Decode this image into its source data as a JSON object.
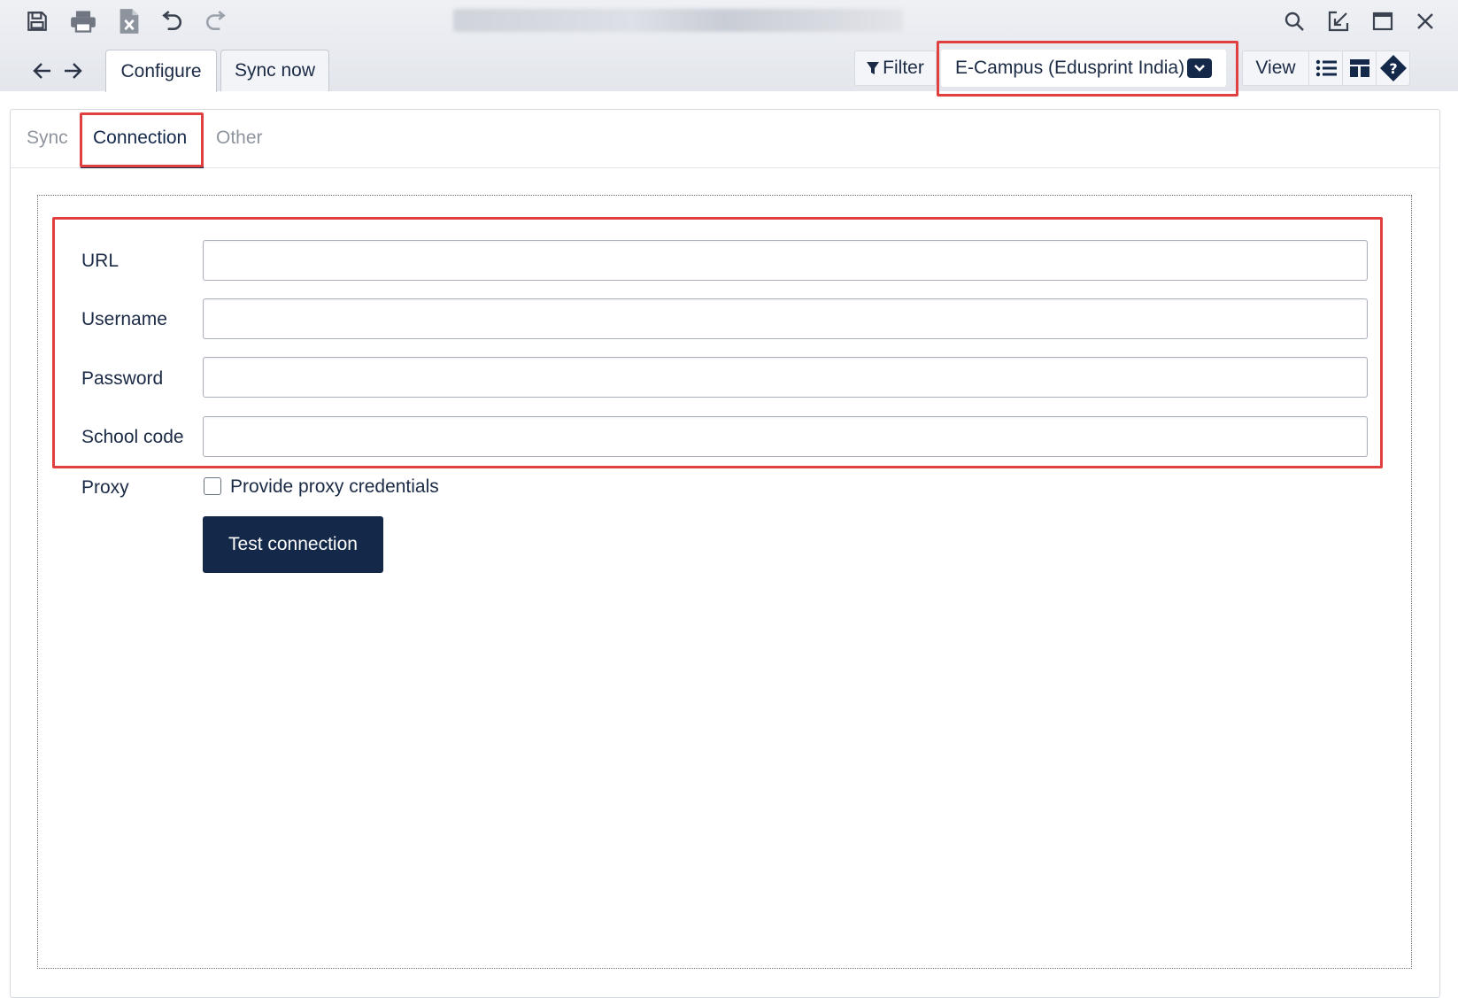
{
  "toolbar": {
    "save": "save-icon",
    "print": "print-icon",
    "export": "export-excel-icon",
    "undo": "undo-icon",
    "redo": "redo-icon"
  },
  "window_controls": [
    "search-icon",
    "popout-icon",
    "maximize-icon",
    "close-icon"
  ],
  "nav": {
    "back": "arrow-left-icon",
    "forward": "arrow-right-icon"
  },
  "main_tabs": [
    {
      "label": "Configure",
      "active": true
    },
    {
      "label": "Sync now",
      "active": false
    }
  ],
  "header_right": {
    "filter_label": "Filter",
    "source_select_value": "E-Campus (Edusprint India)",
    "view_label": "View"
  },
  "sub_tabs": [
    {
      "label": "Sync",
      "active": false
    },
    {
      "label": "Connection",
      "active": true
    },
    {
      "label": "Other",
      "active": false
    }
  ],
  "form": {
    "fields": [
      {
        "label": "URL",
        "value": ""
      },
      {
        "label": "Username",
        "value": ""
      },
      {
        "label": "Password",
        "value": ""
      },
      {
        "label": "School code",
        "value": ""
      }
    ],
    "proxy_label": "Proxy",
    "proxy_checkbox_label": "Provide proxy credentials",
    "proxy_checked": false,
    "test_button_label": "Test connection"
  },
  "colors": {
    "accent": "#14294a",
    "highlight": "#e0403f",
    "muted_text": "#8f959f"
  }
}
